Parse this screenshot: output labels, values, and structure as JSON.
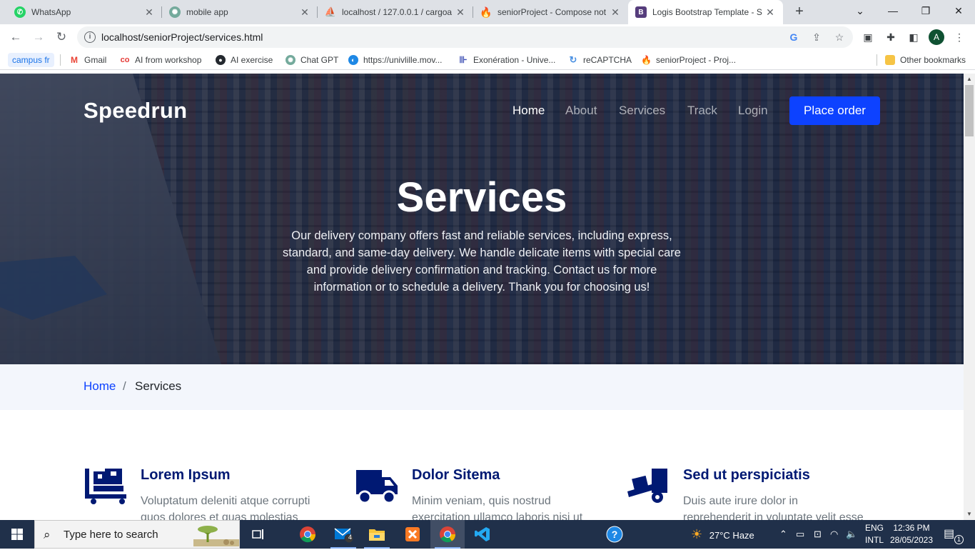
{
  "tabs": [
    {
      "title": "WhatsApp",
      "icon": "whatsapp-icon",
      "color": "#25d366"
    },
    {
      "title": "mobile app",
      "icon": "chatgpt-icon",
      "color": "#74aa9c"
    },
    {
      "title": "localhost / 127.0.0.1 / cargoa",
      "icon": "phpmyadmin-icon",
      "color": "#f29111"
    },
    {
      "title": "seniorProject - Compose not",
      "icon": "firebase-icon",
      "color": "#ffca28"
    },
    {
      "title": "Logis Bootstrap Template - S",
      "icon": "bootstrap-icon",
      "color": "#7952b3"
    }
  ],
  "address_bar": {
    "url": "localhost/seniorProject/services.html"
  },
  "bookmarks": [
    {
      "label": "campus fr"
    },
    {
      "label": "Gmail"
    },
    {
      "label": "AI from workshop"
    },
    {
      "label": "AI exercise"
    },
    {
      "label": "Chat GPT"
    },
    {
      "label": "https://univlille.mov..."
    },
    {
      "label": "Exonération - Unive..."
    },
    {
      "label": "reCAPTCHA"
    },
    {
      "label": "seniorProject - Proj..."
    },
    {
      "label": "Other bookmarks"
    }
  ],
  "site": {
    "logo": "Speedrun",
    "nav": [
      "Home",
      "About",
      "Services",
      "Track",
      "Login"
    ],
    "cta": "Place order",
    "accent": "#0d42ff"
  },
  "hero": {
    "title": "Services",
    "subtitle": "Our delivery company offers fast and reliable services, including express, standard, and same-day delivery. We handle delicate items with special care and provide delivery confirmation and tracking. Contact us for more information or to schedule a delivery. Thank you for choosing us!"
  },
  "breadcrumb": {
    "home": "Home",
    "separator": "/",
    "current": "Services"
  },
  "services": [
    {
      "title": "Lorem Ipsum",
      "text": "Voluptatum deleniti atque corrupti quos dolores et quas molestias",
      "icon": "cart-icon"
    },
    {
      "title": "Dolor Sitema",
      "text": "Minim veniam, quis nostrud exercitation ullamco laboris nisi ut",
      "icon": "truck-icon"
    },
    {
      "title": "Sed ut perspiciatis",
      "text": "Duis aute irure dolor in reprehenderit in voluptate velit esse cillum dolore eu",
      "icon": "dolly-icon"
    }
  ],
  "taskbar": {
    "search_placeholder": "Type here to search",
    "mail_badge": "4",
    "weather": "27°C  Haze",
    "lang_line1": "ENG",
    "lang_line2": "INTL",
    "time": "12:36 PM",
    "date": "28/05/2023",
    "notif_badge": "1"
  }
}
